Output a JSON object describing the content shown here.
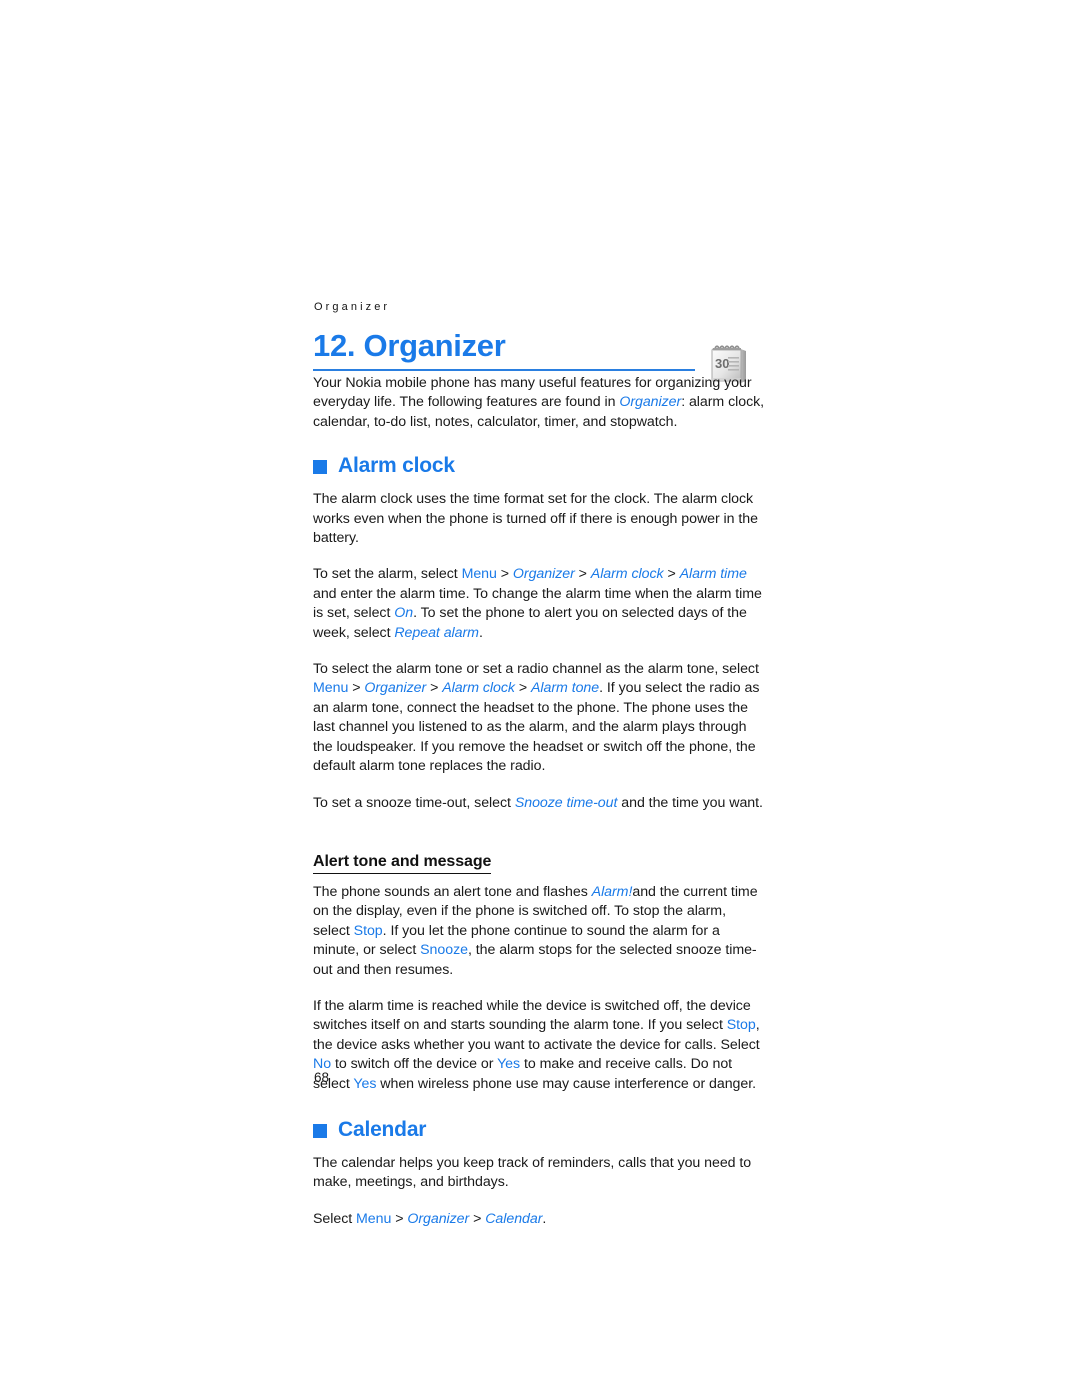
{
  "page": {
    "running_header": "Organizer",
    "folio": "68",
    "accent_blue": "#1a7ae8",
    "rule_blue": "#2a7fe0",
    "text_black": "#1a1a1a"
  },
  "chapter": {
    "title": "12. Organizer",
    "icon_name": "calendar-icon",
    "icon_day_label": "30"
  },
  "intro": {
    "seg_1": "Your Nokia mobile phone has many useful features for organizing your everyday life. The following features are found in ",
    "path_organizer": "Organizer",
    "seg_2": ": alarm clock, calendar, to-do list, notes, calculator, timer, and stopwatch."
  },
  "alarm_clock": {
    "heading": "Alarm clock",
    "p1": "The alarm clock uses the time format set for the clock. The alarm clock works even when the phone is turned off if there is enough power in the battery.",
    "p2": {
      "seg_1": "To set the alarm, select ",
      "ui_menu": "Menu",
      "sep_1": " > ",
      "path_organizer": "Organizer",
      "sep_2": " > ",
      "path_alarm_clock": "Alarm clock",
      "sep_3": " > ",
      "path_alarm_time": "Alarm time",
      "seg_2": " and enter the alarm time. To change the alarm time when the alarm time is set, select ",
      "path_on": "On",
      "seg_3": ". To set the phone to alert you on selected days of the week, select ",
      "path_repeat_alarm": "Repeat alarm",
      "seg_4": "."
    },
    "p3": {
      "seg_1": "To select the alarm tone or set a radio channel as the alarm tone, select ",
      "ui_menu": "Menu",
      "sep_1": " > ",
      "path_organizer": "Organizer",
      "sep_2": " > ",
      "path_alarm_clock": "Alarm clock",
      "sep_3": " > ",
      "path_alarm_tone": "Alarm tone",
      "seg_2": ". If you select the radio as an alarm tone, connect the headset to the phone. The phone uses the last channel you listened to as the alarm, and the alarm plays through the loudspeaker. If you remove the headset or switch off the phone, the default alarm tone replaces the radio."
    },
    "p4": {
      "seg_1": "To set a snooze time-out, select ",
      "path_snooze": "Snooze time-out",
      "seg_2": " and the time you want."
    }
  },
  "alert_tone": {
    "heading": "Alert tone and message",
    "p1": {
      "seg_1": "The phone sounds an alert tone and flashes ",
      "path_alarm_excl": "Alarm!",
      "seg_2": "and the current time on the display, even if the phone is switched off. To stop the alarm, select ",
      "ui_stop": "Stop",
      "seg_3": ". If you let the phone continue to sound the alarm for a minute, or select ",
      "ui_snooze": "Snooze",
      "seg_4": ", the alarm stops for the selected snooze time-out and then resumes."
    },
    "p2": {
      "seg_1": "If the alarm time is reached while the device is switched off, the device switches itself on and starts sounding the alarm tone. If you select ",
      "ui_stop": "Stop",
      "seg_2": ", the device asks whether you want to activate the device for calls. Select ",
      "ui_no": "No",
      "seg_3": " to switch off the device or ",
      "ui_yes_1": "Yes",
      "seg_4": " to make and receive calls. Do not select ",
      "ui_yes_2": "Yes",
      "seg_5": " when wireless phone use may cause interference or danger."
    }
  },
  "calendar": {
    "heading": "Calendar",
    "p1": "The calendar helps you keep track of reminders, calls that you need to make, meetings, and birthdays.",
    "p2": {
      "seg_1": "Select ",
      "ui_menu": "Menu",
      "sep_1": " > ",
      "path_organizer": "Organizer",
      "sep_2": " > ",
      "path_calendar": "Calendar",
      "seg_2": "."
    }
  }
}
